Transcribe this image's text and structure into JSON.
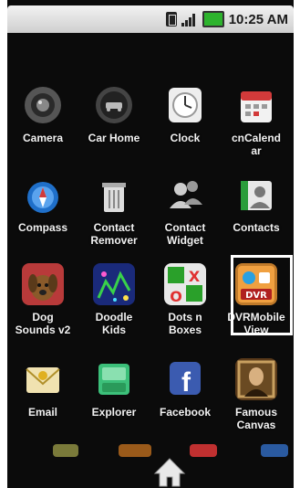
{
  "status_bar": {
    "time": "10:25 AM",
    "icons": [
      "sim-icon",
      "signal-icon",
      "battery-icon"
    ]
  },
  "apps": [
    {
      "label": "Camera",
      "icon": "camera-icon"
    },
    {
      "label": "Car Home",
      "icon": "car-home-icon"
    },
    {
      "label": "Clock",
      "icon": "clock-icon"
    },
    {
      "label": "cnCalendar",
      "icon": "calendar-icon"
    },
    {
      "label": "Compass",
      "icon": "compass-icon"
    },
    {
      "label": "Contact Remover",
      "icon": "contact-remover-icon"
    },
    {
      "label": "Contact Widget",
      "icon": "contact-widget-icon"
    },
    {
      "label": "Contacts",
      "icon": "contacts-icon"
    },
    {
      "label": "Dog Sounds v2",
      "icon": "dog-icon"
    },
    {
      "label": "Doodle Kids",
      "icon": "doodle-icon"
    },
    {
      "label": "Dots n Boxes",
      "icon": "dots-boxes-icon"
    },
    {
      "label": "DVRMobile View",
      "icon": "dvr-icon"
    },
    {
      "label": "Email",
      "icon": "email-icon"
    },
    {
      "label": "Explorer",
      "icon": "explorer-icon"
    },
    {
      "label": "Facebook",
      "icon": "facebook-icon"
    },
    {
      "label": "Famous Canvas",
      "icon": "canvas-icon"
    }
  ],
  "colors": {
    "background": "#0b0b0b",
    "selection_border": "#ffffff",
    "battery": "#2db32d"
  }
}
